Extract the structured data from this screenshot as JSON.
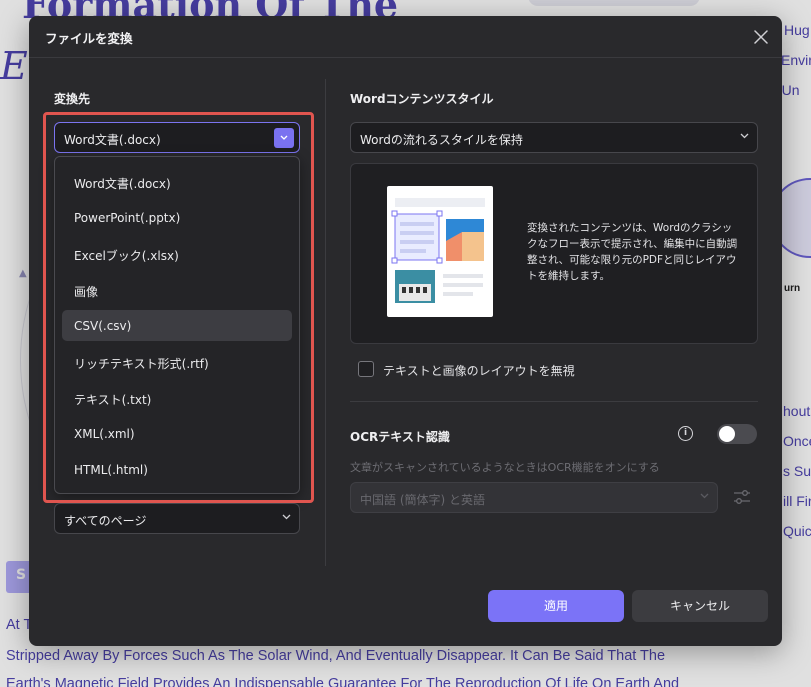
{
  "background": {
    "title_line1": "Formation Of The",
    "title_line2": "Ea",
    "button_fragment": "S",
    "right_fragments": [
      "Hug",
      "Envir",
      "e Un",
      "urn",
      "hout",
      "Once",
      "s Surl",
      "ill Fir",
      "Quick"
    ],
    "body_lines": [
      "At T",
      "Stripped Away By Forces Such As The Solar Wind, And Eventually Disappear. It Can Be Said That The",
      "Earth's Magnetic Field Provides An Indispensable Guarantee For The Reproduction Of Life On Earth And"
    ]
  },
  "dialog": {
    "title": "ファイルを変換",
    "close_icon": "close-icon",
    "left": {
      "section_label": "変換先",
      "format_select": {
        "value": "Word文書(.docx)"
      },
      "format_options": [
        "Word文書(.docx)",
        "PowerPoint(.pptx)",
        "Excelブック(.xlsx)",
        "画像",
        "CSV(.csv)",
        "リッチテキスト形式(.rtf)",
        "テキスト(.txt)",
        "XML(.xml)",
        "HTML(.html)"
      ],
      "highlighted_option": "CSV(.csv)",
      "page_range_select": {
        "value": "すべてのページ"
      }
    },
    "right": {
      "style_label": "Wordコンテンツスタイル",
      "style_select": {
        "value": "Wordの流れるスタイルを保持"
      },
      "preview_description": "変換されたコンテンツは、Wordのクラシックなフロー表示で提示され、編集中に自動調整され、可能な限り元のPDFと同じレイアウトを維持します。",
      "ignore_layout_checkbox": {
        "label": "テキストと画像のレイアウトを無視",
        "checked": false
      },
      "ocr": {
        "label": "OCRテキスト認識",
        "enabled": false,
        "description": "文章がスキャンされているようなときはOCR機能をオンにする",
        "language_select": {
          "value": "中国語 (簡体字) と英語"
        }
      }
    },
    "buttons": {
      "apply": "適用",
      "cancel": "キャンセル"
    }
  },
  "colors": {
    "dialog_bg": "#29292c",
    "accent": "#7b73f7",
    "highlight_frame": "#e0554f",
    "background_text": "#5046b5"
  }
}
